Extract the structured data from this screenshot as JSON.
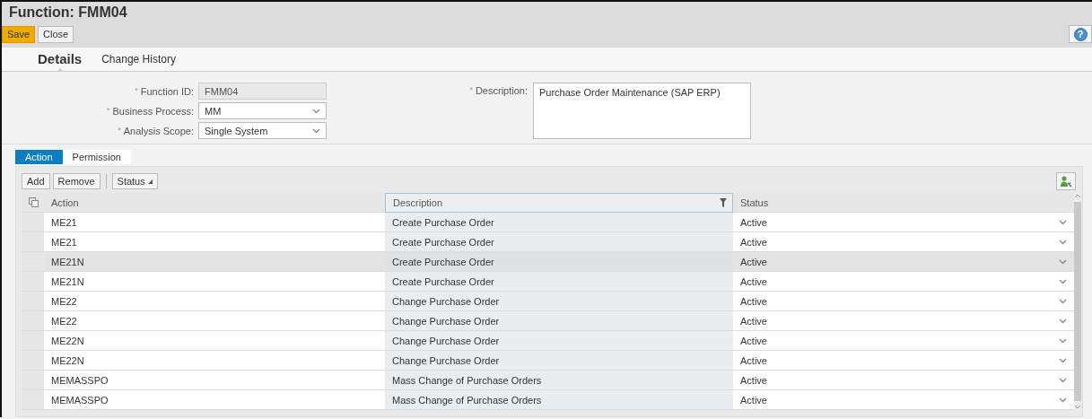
{
  "window": {
    "title": "Function: FMM04"
  },
  "toolbar": {
    "buttons": [
      {
        "label": "Save",
        "kind": "primary"
      },
      {
        "label": "Close",
        "kind": "plain"
      }
    ],
    "help": "?"
  },
  "tabs": [
    {
      "label": "Details",
      "selected": true
    },
    {
      "label": "Change History",
      "selected": false
    }
  ],
  "form": {
    "left": [
      {
        "required_mark": "*",
        "label": "Function ID:",
        "value": "FMM04",
        "kind": "readonly"
      },
      {
        "required_mark": "*",
        "label": "Business Process:",
        "value": "MM",
        "kind": "dropdown"
      },
      {
        "required_mark": "*",
        "label": "Analysis Scope:",
        "value": "Single System",
        "kind": "dropdown"
      }
    ],
    "description": {
      "required_mark": "*",
      "label": "Description:",
      "value": "Purchase Order Maintenance (SAP ERP)"
    }
  },
  "subtabs": [
    {
      "label": "Action",
      "selected": true
    },
    {
      "label": "Permission",
      "selected": false
    }
  ],
  "table": {
    "toolbar": [
      {
        "label": "Add",
        "kind": "button"
      },
      {
        "label": "Remove",
        "kind": "button"
      },
      {
        "label": "Status",
        "kind": "menu"
      }
    ],
    "columns": [
      {
        "label": "Action",
        "filtered": false
      },
      {
        "label": "Description",
        "filtered": true
      },
      {
        "label": "Status",
        "filtered": false
      }
    ],
    "rows": [
      {
        "action": "ME21",
        "description": "Create Purchase Order",
        "status": "Active",
        "selected": false
      },
      {
        "action": "ME21",
        "description": "Create Purchase Order",
        "status": "Active",
        "selected": false
      },
      {
        "action": "ME21N",
        "description": "Create Purchase Order",
        "status": "Active",
        "selected": true
      },
      {
        "action": "ME21N",
        "description": "Create Purchase Order",
        "status": "Active",
        "selected": false
      },
      {
        "action": "ME22",
        "description": "Change Purchase Order",
        "status": "Active",
        "selected": false
      },
      {
        "action": "ME22",
        "description": "Change Purchase Order",
        "status": "Active",
        "selected": false
      },
      {
        "action": "ME22N",
        "description": "Change Purchase Order",
        "status": "Active",
        "selected": false
      },
      {
        "action": "ME22N",
        "description": "Change Purchase Order",
        "status": "Active",
        "selected": false
      },
      {
        "action": "MEMASSPO",
        "description": "Mass Change of Purchase Orders",
        "status": "Active",
        "selected": false
      },
      {
        "action": "MEMASSPO",
        "description": "Mass Change of Purchase Orders",
        "status": "Active",
        "selected": false
      }
    ]
  }
}
